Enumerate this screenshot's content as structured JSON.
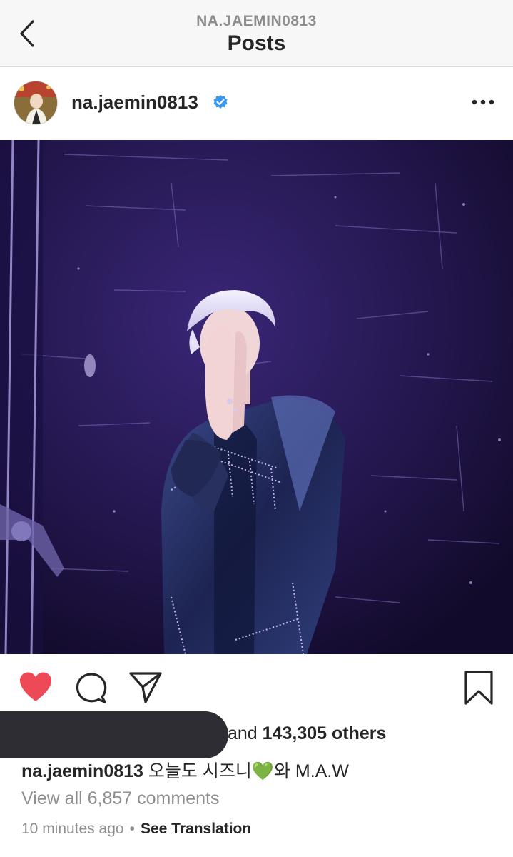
{
  "nav": {
    "account_handle": "NA.JAEMIN0813",
    "title": "Posts",
    "back_icon": "chevron-left-icon"
  },
  "post": {
    "username": "na.jaemin0813",
    "verified": true,
    "verified_color": "#3897f0",
    "more_icon": "ellipsis-icon",
    "photo_description": "performer in purple-lit backstage, blond hair, satin jacket with crystal fringe",
    "actions": {
      "liked": true,
      "like_color": "#ed4956",
      "icons": [
        "heart-icon",
        "comment-icon",
        "share-icon",
        "bookmark-icon"
      ]
    },
    "likes_prefix": "and ",
    "likes_count": "143,305 others",
    "caption_user": "na.jaemin0813",
    "caption_text": "오늘도 시즈니",
    "caption_emoji": "💚",
    "caption_suffix": "와 M.A.W",
    "view_comments": "View all 6,857 comments",
    "timestamp": "10 minutes ago",
    "separator": "•",
    "see_translation": "See Translation"
  }
}
